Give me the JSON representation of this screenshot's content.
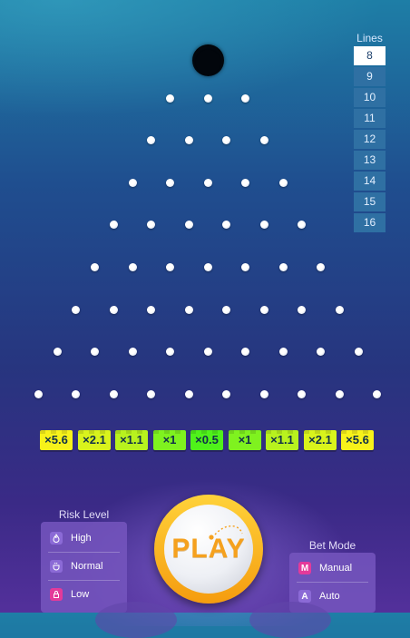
{
  "lines": {
    "title": "Lines",
    "options": [
      "8",
      "9",
      "10",
      "11",
      "12",
      "13",
      "14",
      "15",
      "16"
    ],
    "selected": "8"
  },
  "pegs": {
    "rows": 8
  },
  "multipliers": [
    {
      "label": "×5.6",
      "color": "#f7f21a"
    },
    {
      "label": "×2.1",
      "color": "#d9f31c"
    },
    {
      "label": "×1.1",
      "color": "#b8f21e"
    },
    {
      "label": "×1",
      "color": "#7ff21f"
    },
    {
      "label": "×0.5",
      "color": "#4ff21a"
    },
    {
      "label": "×1",
      "color": "#7ff21f"
    },
    {
      "label": "×1.1",
      "color": "#b8f21e"
    },
    {
      "label": "×2.1",
      "color": "#d9f31c"
    },
    {
      "label": "×5.6",
      "color": "#f7f21a"
    }
  ],
  "risk": {
    "title": "Risk Level",
    "options": [
      {
        "label": "High",
        "icon": "flame-icon"
      },
      {
        "label": "Normal",
        "icon": "cup-icon"
      },
      {
        "label": "Low",
        "icon": "lock-icon"
      }
    ]
  },
  "play_button": {
    "label": "PLAY",
    "color": "#f5a11e"
  },
  "bet_mode": {
    "title": "Bet Mode",
    "options": [
      {
        "label": "Manual",
        "badge": "M"
      },
      {
        "label": "Auto",
        "badge": "A"
      }
    ]
  }
}
